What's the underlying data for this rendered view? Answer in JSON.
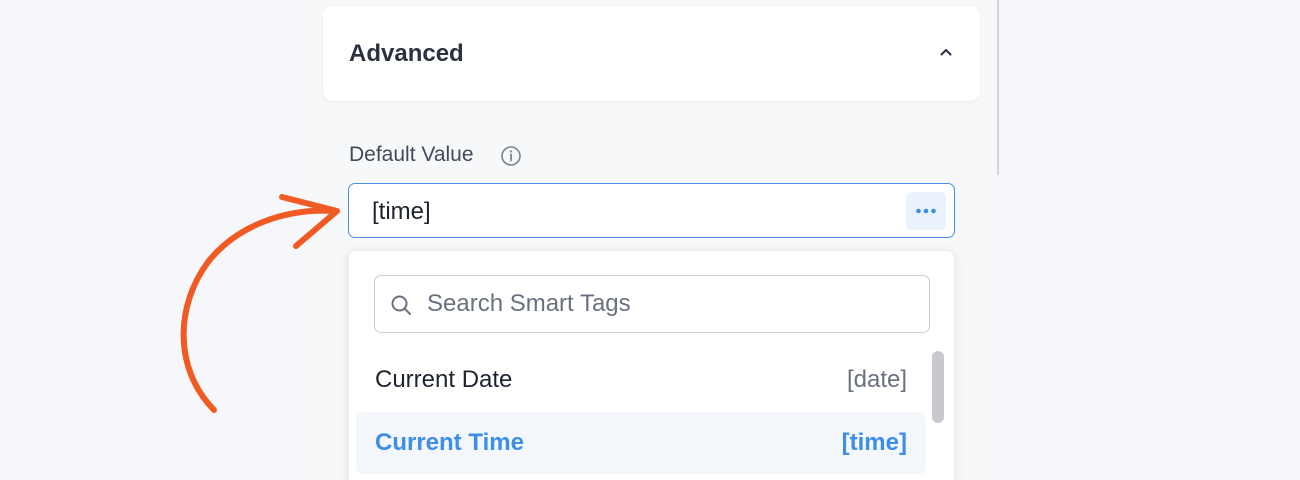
{
  "section": {
    "title": "Advanced",
    "toggle_icon": "chevron-up-icon"
  },
  "field": {
    "label": "Default Value",
    "info_icon": "info-circle-icon",
    "value": "[time]",
    "smart_tag_icon": "more-horizontal-icon"
  },
  "dropdown": {
    "search_placeholder": "Search Smart Tags",
    "search_icon": "search-icon",
    "items": [
      {
        "label": "Current Date",
        "tag": "[date]",
        "active": false
      },
      {
        "label": "Current Time",
        "tag": "[time]",
        "active": true
      }
    ]
  },
  "annotation": {
    "icon": "curved-arrow-icon",
    "color": "#f15a22"
  },
  "colors": {
    "accent": "#3d8ee8",
    "field_border": "#4a8fe7",
    "background": "#f6f7fa"
  }
}
